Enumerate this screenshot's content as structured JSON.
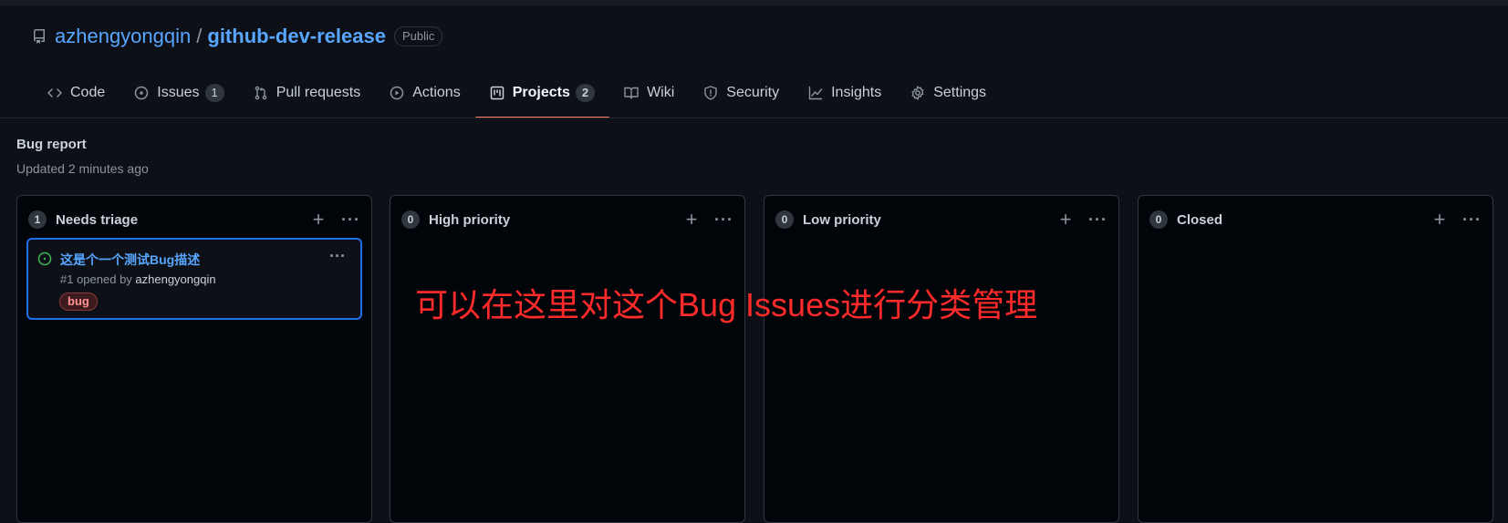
{
  "repo": {
    "owner": "azhengyongqin",
    "separator": "/",
    "name": "github-dev-release",
    "visibility": "Public",
    "icon": "repo-icon"
  },
  "tabs": [
    {
      "label": "Code",
      "icon": "code-icon",
      "count": null,
      "selected": false
    },
    {
      "label": "Issues",
      "icon": "issue-opened-icon",
      "count": "1",
      "selected": false
    },
    {
      "label": "Pull requests",
      "icon": "git-pull-request-icon",
      "count": null,
      "selected": false
    },
    {
      "label": "Actions",
      "icon": "play-icon",
      "count": null,
      "selected": false
    },
    {
      "label": "Projects",
      "icon": "project-icon",
      "count": "2",
      "selected": true
    },
    {
      "label": "Wiki",
      "icon": "book-icon",
      "count": null,
      "selected": false
    },
    {
      "label": "Security",
      "icon": "shield-icon",
      "count": null,
      "selected": false
    },
    {
      "label": "Insights",
      "icon": "graph-icon",
      "count": null,
      "selected": false
    },
    {
      "label": "Settings",
      "icon": "gear-icon",
      "count": null,
      "selected": false
    }
  ],
  "project": {
    "title": "Bug report",
    "updated": "Updated 2 minutes ago"
  },
  "columns": [
    {
      "count": "1",
      "name": "Needs triage"
    },
    {
      "count": "0",
      "name": "High priority"
    },
    {
      "count": "0",
      "name": "Low priority"
    },
    {
      "count": "0",
      "name": "Closed"
    }
  ],
  "card": {
    "title": "这是个一个测试Bug描述",
    "meta_prefix": "#1 opened by ",
    "author": "azhengyongqin",
    "label": "bug",
    "status_icon": "issue-opened-icon"
  },
  "annotation": "可以在这里对这个Bug Issues进行分类管理",
  "colors": {
    "bg": "#0d1117",
    "column_bg": "#010409",
    "link": "#58a6ff",
    "selected_underline": "#f78166",
    "card_border": "#1f6feb",
    "open_status": "#3fb950",
    "annotation": "#ff2a2a",
    "bug_label": "#ff9492"
  }
}
